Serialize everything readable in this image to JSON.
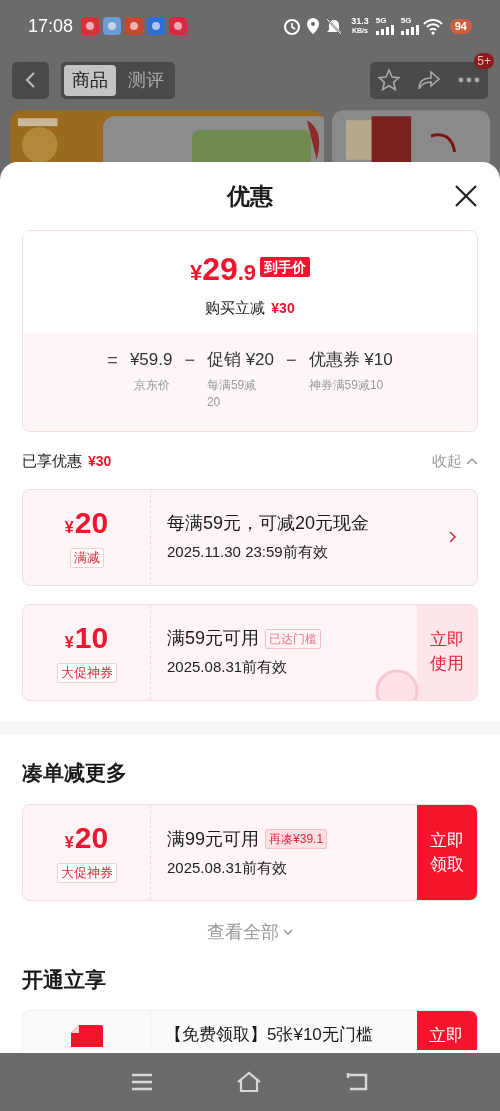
{
  "status_bar": {
    "time": "17:08",
    "speed": "31.3",
    "speed_unit": "KB/s",
    "network_1": "5G",
    "network_2": "5G",
    "battery": "94"
  },
  "nav": {
    "tabs": [
      {
        "label": "商品",
        "selected": true
      },
      {
        "label": "测评",
        "selected": false
      }
    ],
    "more_badge": "5+"
  },
  "sheet": {
    "title": "优惠",
    "summary": {
      "price_symbol": "¥",
      "price_main": "29",
      "price_decimal": ".9",
      "price_tag": "到手价",
      "saving_label": "购买立减",
      "saving_value": "¥30",
      "formula": [
        {
          "operator": "=",
          "value": "¥59.9",
          "caption": "京东价"
        },
        {
          "operator": "−",
          "value": "促销 ¥20",
          "caption": "每满59减20"
        },
        {
          "operator": "−",
          "value": "优惠券 ¥10",
          "caption": "神券满59减10"
        }
      ]
    },
    "enjoyed": {
      "label": "已享优惠",
      "value": "¥30",
      "toggle": "收起",
      "expanded": true
    },
    "enjoyed_coupons": [
      {
        "kind": "promo",
        "symbol": "¥",
        "amount": "20",
        "type_label": "满减",
        "title": "每满59元，可减20元现金",
        "validity": "2025.11.30 23:59前有效"
      },
      {
        "kind": "coupon",
        "symbol": "¥",
        "amount": "10",
        "type_label": "大促神券",
        "title": "满59元可用",
        "tag": "已达门槛",
        "validity": "2025.08.31前有效",
        "action": "立即使用",
        "primary": false,
        "stamped": true
      }
    ],
    "more_section": {
      "title": "凑单减更多",
      "coupons": [
        {
          "kind": "coupon",
          "symbol": "¥",
          "amount": "20",
          "type_label": "大促神券",
          "title": "满99元可用",
          "tag": "再凑¥39.1",
          "validity": "2025.08.31前有效",
          "action": "立即领取",
          "primary": true,
          "stamped": false
        }
      ],
      "view_all": "查看全部"
    },
    "open_section": {
      "title": "开通立享",
      "offer": {
        "title": "【免费领取】5张¥10无门槛",
        "action": "立即"
      }
    }
  }
}
